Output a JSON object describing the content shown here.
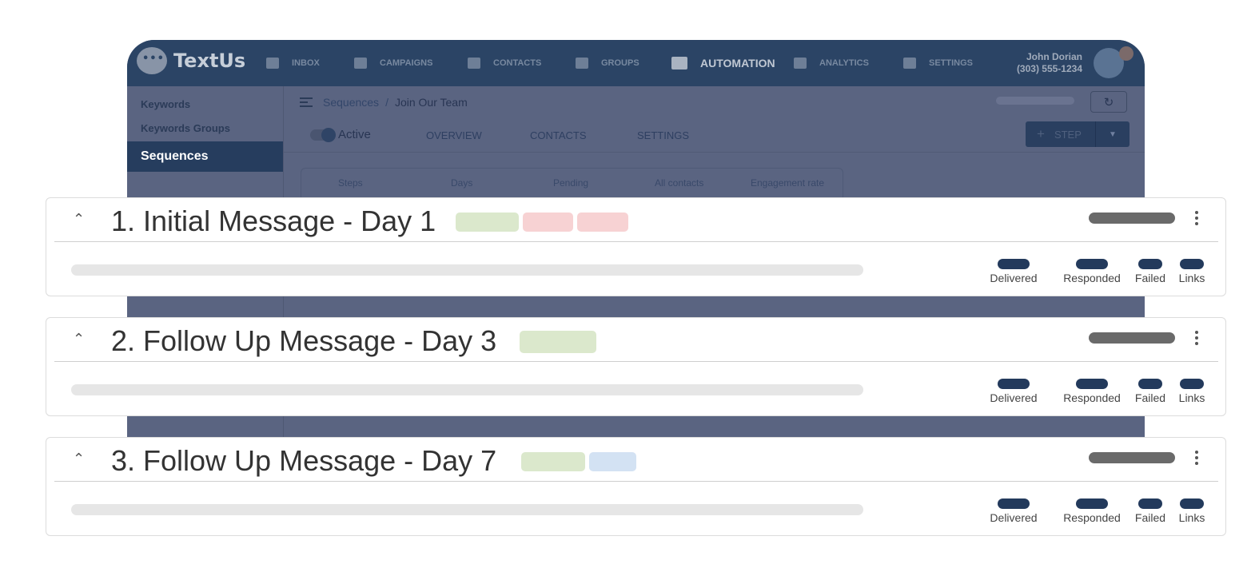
{
  "app": {
    "logo_text": "TextUs",
    "nav": [
      {
        "label": "INBOX",
        "icon": "inbox-icon"
      },
      {
        "label": "CAMPAIGNS",
        "icon": "megaphone-icon"
      },
      {
        "label": "CONTACTS",
        "icon": "contact-card-icon"
      },
      {
        "label": "GROUPS",
        "icon": "users-icon"
      },
      {
        "label": "AUTOMATION",
        "icon": "robot-icon",
        "active": true
      },
      {
        "label": "ANALYTICS",
        "icon": "bar-chart-icon"
      },
      {
        "label": "SETTINGS",
        "icon": "gear-icon"
      }
    ],
    "user": {
      "name": "John Dorian",
      "phone": "(303) 555-1234"
    },
    "sidebar": {
      "items": [
        "Keywords",
        "Keywords Groups"
      ],
      "active_item": "Sequences"
    },
    "breadcrumb": {
      "parent": "Sequences",
      "separator": "/",
      "current": "Join Our Team"
    },
    "subnav": {
      "toggle_label": "Active",
      "tabs": [
        "OVERVIEW",
        "CONTACTS",
        "SETTINGS"
      ],
      "step_button": "STEP"
    },
    "stats_headers": [
      "Steps",
      "Days",
      "Pending",
      "All contacts",
      "Engagement rate"
    ]
  },
  "colors": {
    "tag_green": "#dbe8cc",
    "tag_red": "#f7d2d3",
    "tag_blue": "#d3e2f3",
    "metric_pill": "#233a5c",
    "status_pill": "#6a6a6a"
  },
  "cards": [
    {
      "title": "1. Initial Message - Day 1",
      "tags": [
        "green",
        "red",
        "red"
      ],
      "metrics": [
        "Delivered",
        "Responded",
        "Failed",
        "Links"
      ]
    },
    {
      "title": "2. Follow Up Message - Day 3",
      "tags": [
        "green"
      ],
      "metrics": [
        "Delivered",
        "Responded",
        "Failed",
        "Links"
      ]
    },
    {
      "title": "3. Follow Up Message - Day 7",
      "tags": [
        "green",
        "blue"
      ],
      "metrics": [
        "Delivered",
        "Responded",
        "Failed",
        "Links"
      ]
    }
  ]
}
